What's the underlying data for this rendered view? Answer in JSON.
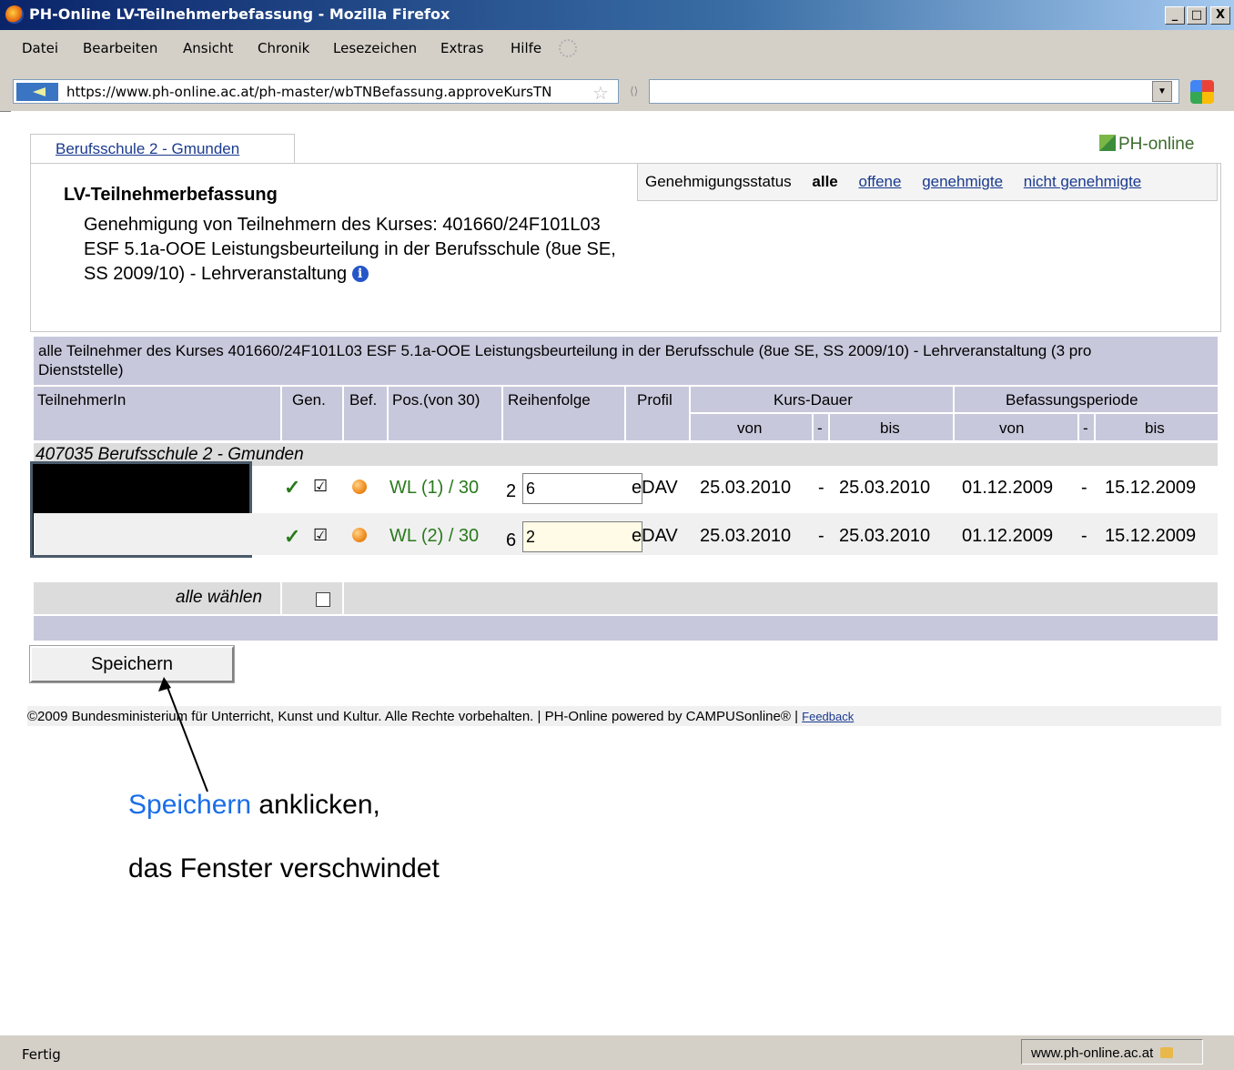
{
  "window": {
    "title": "PH-Online LV-Teilnehmerbefassung - Mozilla Firefox",
    "buttons": {
      "minimize": "_",
      "maximize": "□",
      "close": "X"
    }
  },
  "menu": {
    "items": [
      {
        "label": "Datei"
      },
      {
        "label": "Bearbeiten"
      },
      {
        "label": "Ansicht"
      },
      {
        "label": "Chronik"
      },
      {
        "label": "Lesezeichen"
      },
      {
        "label": "Extras"
      },
      {
        "label": "Hilfe"
      }
    ]
  },
  "nav": {
    "url": "https://www.ph-online.ac.at/ph-master/wbTNBefassung.approveKursTN",
    "search_value": ""
  },
  "page": {
    "tab_label": "Berufsschule 2 - Gmunden",
    "logo_text": "PH-online",
    "heading": "LV-Teilnehmerbefassung",
    "description": "Genehmigung von Teilnehmern des Kurses: 401660/24F101L03 ESF 5.1a-OOE Leistungsbeurteilung in der Berufsschule (8ue SE, SS 2009/10) - Lehrveranstaltung",
    "status": {
      "label": "Genehmigungsstatus",
      "current": "alle",
      "links": [
        "offene",
        "genehmigte",
        "nicht genehmigte"
      ]
    },
    "table": {
      "caption": "alle Teilnehmer des Kurses 401660/24F101L03 ESF 5.1a-OOE Leistungsbeurteilung in der Berufsschule (8ue SE, SS 2009/10) - Lehrveranstaltung (3 pro Dienststelle)",
      "headers": {
        "teilnehmer": "TeilnehmerIn",
        "gen": "Gen.",
        "bef": "Bef.",
        "pos": "Pos.(von 30)",
        "reihenfolge": "Reihenfolge",
        "profil": "Profil",
        "kursdauer": "Kurs-Dauer",
        "befassungsperiode": "Befassungsperiode",
        "von": "von",
        "dash": "-",
        "bis": "bis"
      },
      "group": "407035 Berufsschule 2 - Gmunden",
      "rows": [
        {
          "gen": "✓",
          "checked": "☑",
          "pos": "WL (1) / 30",
          "order_prev": "2",
          "order_input": "6",
          "profil": "eDAV",
          "kurs_von": "25.03.2010",
          "sep": "-",
          "kurs_bis": "25.03.2010",
          "bef_von": "01.12.2009",
          "sep2": "-",
          "bef_bis": "15.12.2009"
        },
        {
          "gen": "✓",
          "checked": "☑",
          "pos": "WL (2) / 30",
          "order_prev": "6",
          "order_input": "2",
          "profil": "eDAV",
          "kurs_von": "25.03.2010",
          "sep": "-",
          "kurs_bis": "25.03.2010",
          "bef_von": "01.12.2009",
          "sep2": "-",
          "bef_bis": "15.12.2009"
        }
      ],
      "select_all_label": "alle wählen"
    },
    "save_button": "Speichern",
    "footer_text": "©2009 Bundesministerium für Unterricht, Kunst und Kultur. Alle Rechte vorbehalten. | PH-Online powered by CAMPUSonline® |",
    "footer_link": "Feedback"
  },
  "annotation": {
    "line1_highlight": "Speichern",
    "line1_rest": " anklicken,",
    "line2": "das Fenster verschwindet",
    "highlight_color": "#1a6ee8"
  },
  "statusbar": {
    "left": "Fertig",
    "host": "www.ph-online.ac.at"
  }
}
